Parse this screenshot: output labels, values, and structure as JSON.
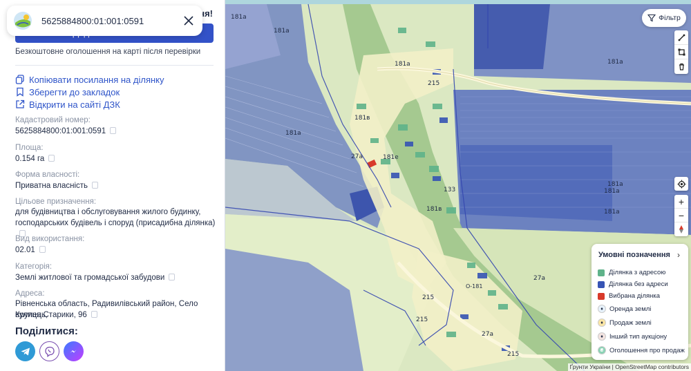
{
  "search": {
    "value": "5625884800:01:001:0591"
  },
  "promo": {
    "title_tail": "ня!",
    "button_label": "Додати оголошення",
    "subtitle": "Безкоштовне оголошення на карті після перевірки"
  },
  "actions": {
    "copy_link": "Копіювати посилання на ділянку",
    "bookmark": "Зберегти до закладок",
    "open_dzk": "Відкрити на сайті ДЗК"
  },
  "fields": {
    "cadastral": {
      "label": "Кадастровий номер:",
      "value": "5625884800:01:001:0591"
    },
    "area": {
      "label": "Площа:",
      "value": "0.154 га"
    },
    "ownership": {
      "label": "Форма власності:",
      "value": "Приватна власність"
    },
    "purpose": {
      "label": "Цільове призначення:",
      "line1": "для будівництва і обслуговування жилого будинку,",
      "line2": "господарських будівель і споруд (присадибна ділянка)"
    },
    "usage": {
      "label": "Вид використання:",
      "value": "02.01"
    },
    "category": {
      "label": "Категорія:",
      "value": "Землі житлової та громадської забудови"
    },
    "address": {
      "label": "Адреса:",
      "line1": "Рівненська область, Радивилівський район, Село Крупець,",
      "line2": "вулиця Старики, 96"
    }
  },
  "share": {
    "title": "Поділитися:"
  },
  "map": {
    "filter_label": "Фільтр",
    "labels": {
      "l181a_1": "181а",
      "l181a_2": "181а",
      "l181a_3": "181а",
      "l181a_4": "181а",
      "l181a_5": "181а",
      "l181a_6": "181а",
      "l181a_7": "181а",
      "l181a_8": "181а",
      "l215_1": "215",
      "l215_2": "215",
      "l215_3": "215",
      "l215_4": "215",
      "l27a_1": "27а",
      "l27a_2": "27а",
      "l27a_3": "27а",
      "l181v_1": "181в",
      "l181v_2": "181в",
      "l181e": "181е",
      "l133": "133",
      "lo181": "О-181"
    },
    "zoom_in": "+",
    "zoom_out": "−"
  },
  "legend": {
    "title": "Умовні позначення",
    "items": {
      "with_address": "Ділянка з адресою",
      "no_address": "Ділянка без адреси",
      "selected": "Вибрана ділянка",
      "rent": "Оренда землі",
      "sale": "Продаж землі",
      "auction": "Інший тип аукціону",
      "listing": "Оголошення про продаж"
    }
  },
  "attribution": "Ґрунти України | OpenStreetMap contributors",
  "colors": {
    "accent": "#2f55c9",
    "button": "#3352c8",
    "with_address": "#5fb38a",
    "no_address": "#3654b4",
    "selected": "#d83a2a"
  }
}
